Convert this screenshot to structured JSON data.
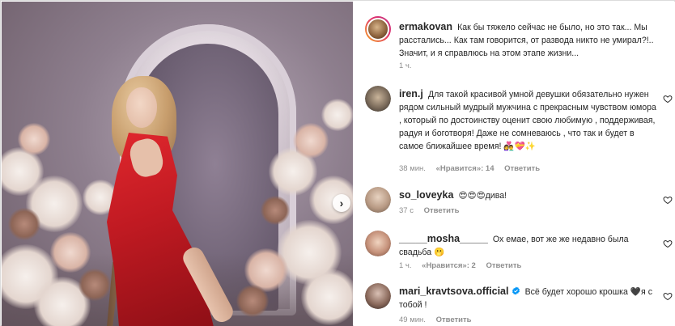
{
  "post": {
    "carousel_next_glyph": "›"
  },
  "caption": {
    "username": "ermakovan",
    "text": "Как бы тяжело сейчас не было, но это так... Мы расстались... Как там говорится, от развода никто не умирал?!.. Значит, и я справлюсь на этом этапе жизни...",
    "time": "1 ч."
  },
  "comments": [
    {
      "username": "iren.j",
      "text": "Для такой красивой умной девушки обязательно нужен рядом сильный мудрый мужчина с прекрасным чувством юмора , который по достоинству оценит свою любимую , поддерживая, радуя и боготворя! Даже не сомневаюсь , что так и будет в самое ближайшее время! 👩‍❤️‍👨💝✨",
      "time": "38 мин.",
      "likes": "«Нравится»: 14",
      "reply": "Ответить"
    },
    {
      "username": "so_loveyka",
      "text": "😍😍😍дива!",
      "time": "37 с",
      "reply": "Ответить"
    },
    {
      "username": "_____mosha_____",
      "text": "Ох емае, вот же же недавно была свадьба 🫢",
      "time": "1 ч.",
      "likes": "«Нравится»: 2",
      "reply": "Ответить"
    },
    {
      "username": "mari_kravtsova.official",
      "verified": true,
      "text": "Всё будет хорошо крошка 🖤я с тобой !",
      "time": "49 мин.",
      "reply": "Ответить"
    }
  ],
  "colors": {
    "accent": "#0095f6",
    "muted": "#8e8e8e",
    "text": "#262626"
  },
  "icons": {
    "like": "heart-outline",
    "verified": "blue-check-badge"
  }
}
